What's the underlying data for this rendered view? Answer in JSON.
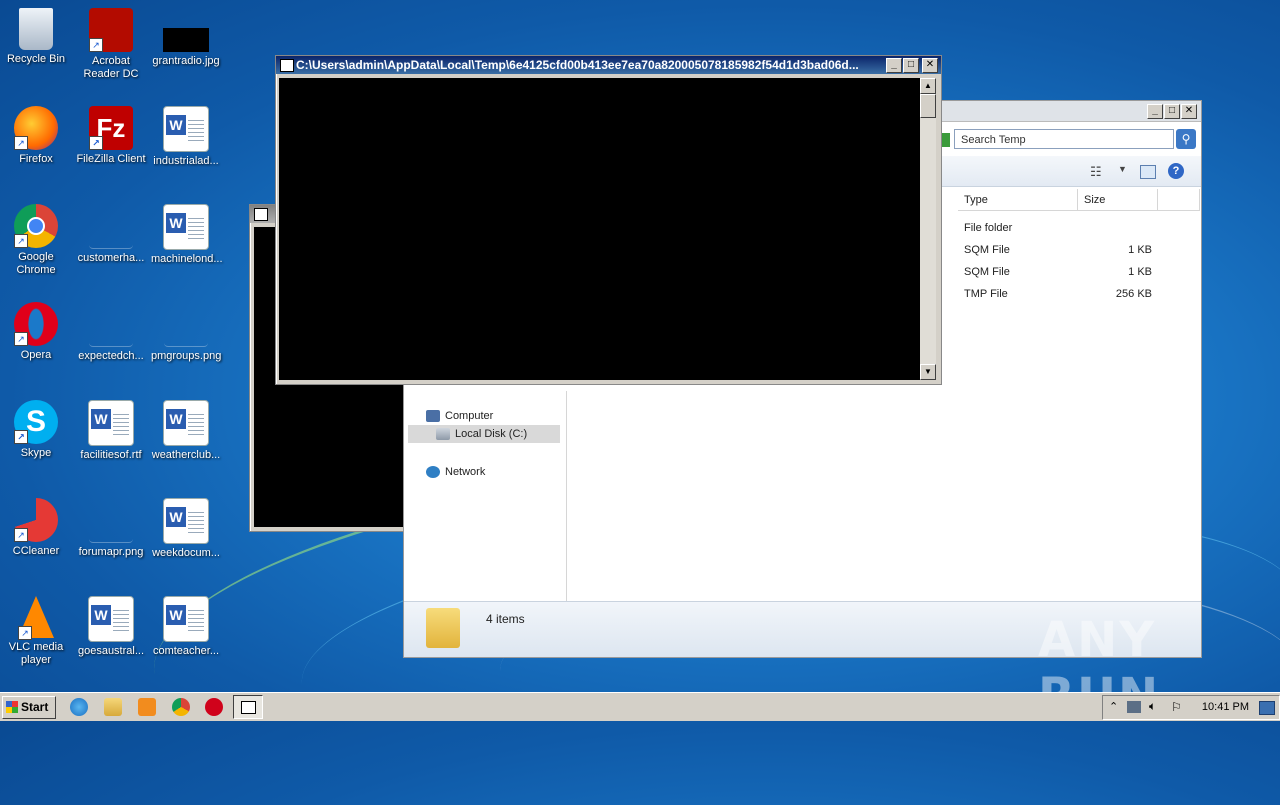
{
  "desktop": {
    "icons": [
      {
        "label": "Recycle Bin",
        "icon": "recycle-bin-icon"
      },
      {
        "label": "Acrobat Reader DC",
        "icon": "acrobat-icon"
      },
      {
        "label": "grantradio.jpg",
        "icon": "image-file-icon"
      },
      {
        "label": "Firefox",
        "icon": "firefox-icon"
      },
      {
        "label": "FileZilla Client",
        "icon": "filezilla-icon"
      },
      {
        "label": "industrialad...",
        "icon": "word-doc-icon"
      },
      {
        "label": "Google Chrome",
        "icon": "chrome-icon"
      },
      {
        "label": "customerha...",
        "icon": "file-icon"
      },
      {
        "label": "machinelond...",
        "icon": "word-doc-icon"
      },
      {
        "label": "Opera",
        "icon": "opera-icon"
      },
      {
        "label": "expectedch...",
        "icon": "file-icon"
      },
      {
        "label": "pmgroups.png",
        "icon": "image-file-icon"
      },
      {
        "label": "Skype",
        "icon": "skype-icon"
      },
      {
        "label": "facilitiesof.rtf",
        "icon": "word-doc-icon"
      },
      {
        "label": "weatherclub...",
        "icon": "word-doc-icon"
      },
      {
        "label": "CCleaner",
        "icon": "ccleaner-icon"
      },
      {
        "label": "forumapr.png",
        "icon": "image-file-icon"
      },
      {
        "label": "weekdocum...",
        "icon": "word-doc-icon"
      },
      {
        "label": "VLC media player",
        "icon": "vlc-icon"
      },
      {
        "label": "goesaustral...",
        "icon": "word-doc-icon"
      },
      {
        "label": "comteacher...",
        "icon": "word-doc-icon"
      }
    ]
  },
  "console": {
    "title": "C:\\Users\\admin\\AppData\\Local\\Temp\\6e4125cfd00b413ee7ea70a820005078185982f54d1d3bad06d..."
  },
  "explorer": {
    "search_placeholder": "Search Temp",
    "columns": {
      "type": "Type",
      "size": "Size"
    },
    "rows": [
      {
        "type": "File folder",
        "size": ""
      },
      {
        "type": "SQM File",
        "size": "1 KB"
      },
      {
        "type": "SQM File",
        "size": "1 KB"
      },
      {
        "type": "TMP File",
        "size": "256 KB"
      }
    ],
    "nav": {
      "computer": "Computer",
      "local_disk": "Local Disk (C:)",
      "network": "Network"
    },
    "status": "4 items"
  },
  "taskbar": {
    "start_label": "Start",
    "clock": "10:41 PM"
  },
  "watermark": "ANY RUN"
}
